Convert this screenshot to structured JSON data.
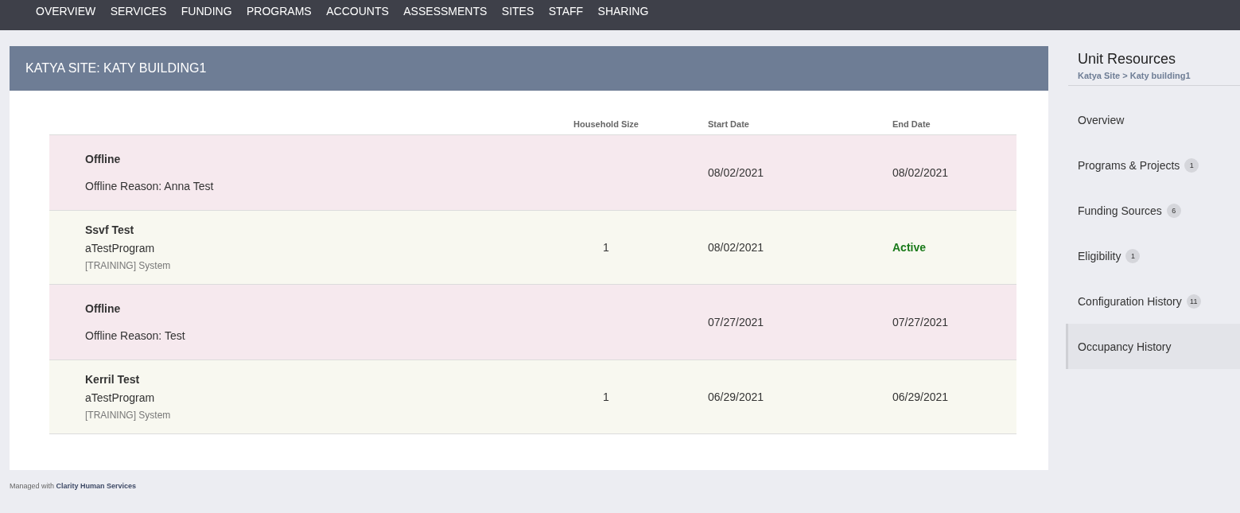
{
  "nav": [
    "OVERVIEW",
    "SERVICES",
    "FUNDING",
    "PROGRAMS",
    "ACCOUNTS",
    "ASSESSMENTS",
    "SITES",
    "STAFF",
    "SHARING"
  ],
  "panel": {
    "title": "KATYA SITE: KATY BUILDING1"
  },
  "table": {
    "columns": [
      "Household Size",
      "Start Date",
      "End Date"
    ],
    "rows": [
      {
        "kind": "offline",
        "title": "Offline",
        "reason": "Offline Reason: Anna Test",
        "start_date": "08/02/2021",
        "end_date": "08/02/2021",
        "active": false
      },
      {
        "kind": "occupancy",
        "title": "Ssvf Test",
        "program": "aTestProgram",
        "system": "[TRAINING] System",
        "household_size": "1",
        "start_date": "08/02/2021",
        "end_date": "Active",
        "active": true
      },
      {
        "kind": "offline",
        "title": "Offline",
        "reason": "Offline Reason: Test",
        "start_date": "07/27/2021",
        "end_date": "07/27/2021",
        "active": false
      },
      {
        "kind": "occupancy",
        "title": "Kerril Test",
        "program": "aTestProgram",
        "system": "[TRAINING] System",
        "household_size": "1",
        "start_date": "06/29/2021",
        "end_date": "06/29/2021",
        "active": false
      }
    ]
  },
  "sidebar": {
    "title": "Unit Resources",
    "breadcrumb": "Katya Site > Katy building1",
    "items": [
      {
        "label": "Overview",
        "selected": false
      },
      {
        "label": "Programs & Projects",
        "count": "1",
        "selected": false
      },
      {
        "label": "Funding Sources",
        "count": "6",
        "selected": false
      },
      {
        "label": "Eligibility",
        "count": "1",
        "selected": false
      },
      {
        "label": "Configuration History",
        "count": "11",
        "selected": false
      },
      {
        "label": "Occupancy History",
        "selected": true
      }
    ]
  },
  "footer": "Managed with **Clarity Human Services**"
}
